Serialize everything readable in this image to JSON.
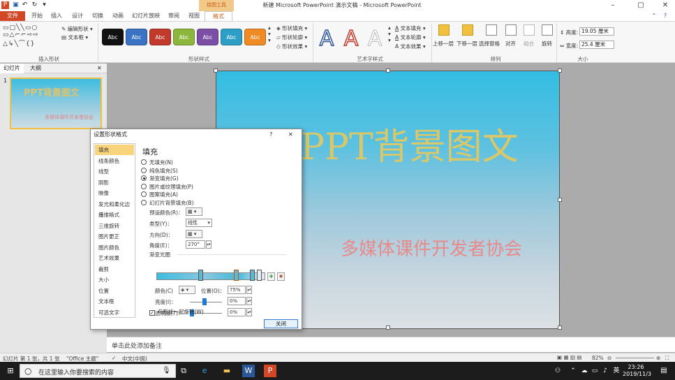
{
  "window": {
    "title": "新建 Microsoft PowerPoint 演示文稿 - Microsoft PowerPoint",
    "context_tab_group": "绘图工具"
  },
  "ribbon_tabs": [
    "文件",
    "开始",
    "插入",
    "设计",
    "切换",
    "动画",
    "幻灯片放映",
    "审阅",
    "视图",
    "格式"
  ],
  "ribbon": {
    "insert_shapes": {
      "label": "插入形状",
      "edit_shape": "编辑形状",
      "text_box": "文本框"
    },
    "shape_styles": {
      "label": "形状样式",
      "buttons": [
        {
          "text": "Abc",
          "color": "#111111"
        },
        {
          "text": "Abc",
          "color": "#3b73c4"
        },
        {
          "text": "Abc",
          "color": "#c0392b"
        },
        {
          "text": "Abc",
          "color": "#8cb63c"
        },
        {
          "text": "Abc",
          "color": "#7b4fa6"
        },
        {
          "text": "Abc",
          "color": "#2d9fc7"
        },
        {
          "text": "Abc",
          "color": "#f08a24"
        }
      ],
      "shape_fill": "形状填充",
      "shape_outline": "形状轮廓",
      "shape_effects": "形状效果"
    },
    "wordart": {
      "label": "艺术字样式",
      "text_fill": "文本填充",
      "text_outline": "文本轮廓",
      "text_effects": "文本效果"
    },
    "arrange": {
      "label": "排列",
      "items": [
        "上移一层",
        "下移一层",
        "选择窗格",
        "对齐",
        "组合",
        "旋转"
      ]
    },
    "size": {
      "label": "大小",
      "height_label": "高度:",
      "height_value": "19.05 厘米",
      "width_label": "宽度:",
      "width_value": "25.4 厘米"
    }
  },
  "left_pane": {
    "tabs": [
      "幻灯片",
      "大纲"
    ],
    "slide_number": "1",
    "thumb_title": "PPT背景图文",
    "thumb_subtitle": "多媒体课件开发者协会"
  },
  "slide": {
    "title": "PPT背景图文",
    "subtitle": "多媒体课件开发者协会"
  },
  "notes_placeholder": "单击此处添加备注",
  "status": {
    "slide_info": "幻灯片 第 1 张，共 1 张",
    "theme": "\"Office 主题\"",
    "language": "中文(中国)",
    "zoom": "82%"
  },
  "taskbar": {
    "search_placeholder": "在这里输入你要搜索的内容",
    "time": "23:26",
    "date": "2019/11/3",
    "ime": "英"
  },
  "dialog": {
    "title": "设置形状格式",
    "help": "?",
    "close": "✕",
    "nav": [
      "填充",
      "线条颜色",
      "线型",
      "阴影",
      "映像",
      "发光和柔化边缘",
      "三维格式",
      "三维旋转",
      "图片更正",
      "图片颜色",
      "艺术效果",
      "裁剪",
      "大小",
      "位置",
      "文本框",
      "可选文字"
    ],
    "heading": "填充",
    "fill_options": [
      "无填充(N)",
      "纯色填充(S)",
      "渐变填充(G)",
      "图片或纹理填充(P)",
      "图案填充(A)",
      "幻灯片背景填充(B)"
    ],
    "selected_fill_index": 2,
    "preset_label": "预设颜色(R)：",
    "type_label": "类型(Y)：",
    "type_value": "线性",
    "direction_label": "方向(D)：",
    "angle_label": "角度(E)：",
    "angle_value": "270°",
    "stops_label": "渐变光圈",
    "color_label": "颜色(C)",
    "position_label": "位置(O)：",
    "position_value": "75%",
    "brightness_label": "亮度(I)：",
    "brightness_value": "0%",
    "transparency_label": "透明度(T)：",
    "transparency_value": "0%",
    "rotate_with_shape": "与形状一起旋转(W)",
    "close_button": "关闭"
  }
}
